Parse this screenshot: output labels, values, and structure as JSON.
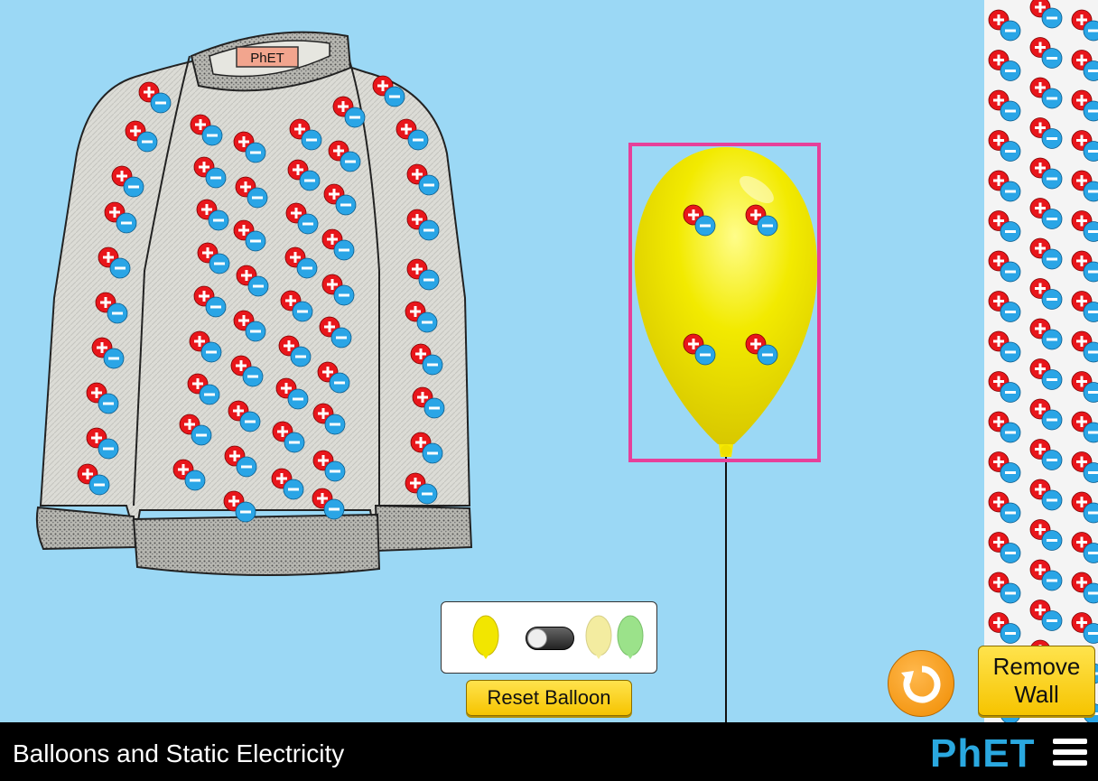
{
  "app": {
    "title": "Balloons and Static Electricity",
    "logo_text": "PhET"
  },
  "sweater": {
    "label": "PhET",
    "color": "#dcdcd6"
  },
  "balloon": {
    "color": "#f0e800"
  },
  "controls": {
    "reset_balloon_label": "Reset Balloon",
    "remove_wall_line1": "Remove",
    "remove_wall_line2": "Wall",
    "balloon_options": [
      {
        "name": "yellow-balloon",
        "color": "#f2e600"
      },
      {
        "name": "pale-yellow-balloon",
        "color": "#f3eca0"
      },
      {
        "name": "green-balloon",
        "color": "#9be28a"
      }
    ],
    "toggle_state": "off"
  },
  "icons": {
    "reset_all": "reset-arrow-icon",
    "menu": "hamburger-menu-icon"
  },
  "colors": {
    "background": "#9bd8f5",
    "selection": "#e6409a",
    "positive": "#e8161b",
    "negative": "#2aa5e6"
  }
}
